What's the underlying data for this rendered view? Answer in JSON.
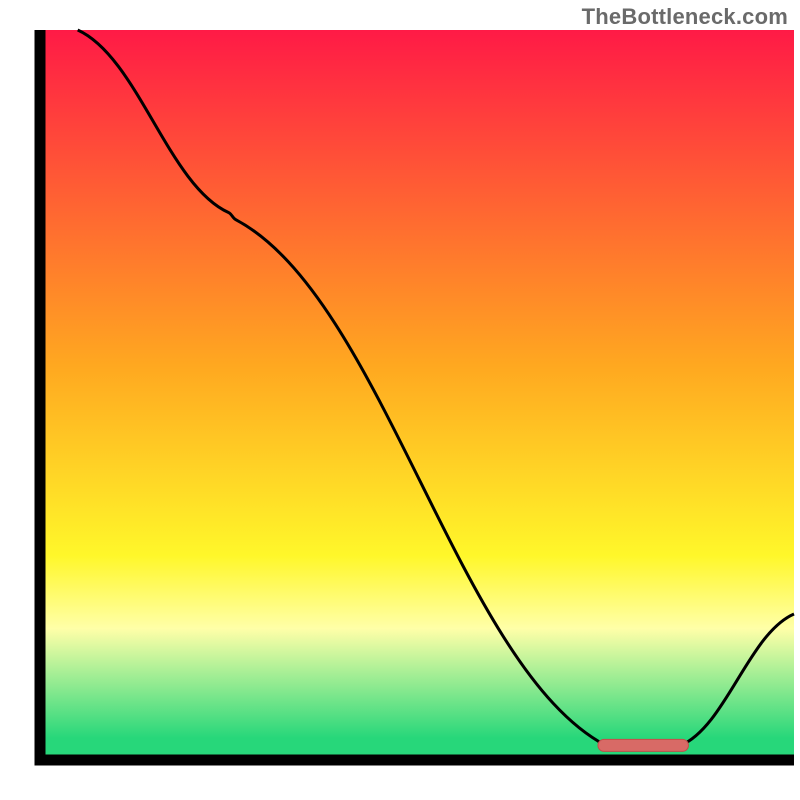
{
  "attribution": "TheBottleneck.com",
  "colors": {
    "red": "#ff1a46",
    "orange": "#ffa820",
    "yellow": "#fff72a",
    "pale": "#ffffa8",
    "green": "#27d77a",
    "line": "#000000",
    "frame": "#000000",
    "marker_fill": "#d86a66",
    "marker_stroke": "#c34d4a"
  },
  "chart_data": {
    "type": "line",
    "title": "",
    "xlabel": "",
    "ylabel": "",
    "xlim": [
      0,
      100
    ],
    "ylim": [
      0,
      100
    ],
    "x": [
      5,
      25,
      26,
      75,
      85,
      100
    ],
    "values": [
      100,
      75,
      74,
      2,
      2,
      20
    ],
    "marker": {
      "x_start": 74,
      "x_end": 86,
      "y": 2
    },
    "gradient_stops": [
      {
        "pos": 0,
        "c": "red"
      },
      {
        "pos": 46,
        "c": "orange"
      },
      {
        "pos": 72,
        "c": "yellow"
      },
      {
        "pos": 82,
        "c": "pale"
      },
      {
        "pos": 97,
        "c": "green"
      },
      {
        "pos": 100,
        "c": "green"
      }
    ]
  }
}
